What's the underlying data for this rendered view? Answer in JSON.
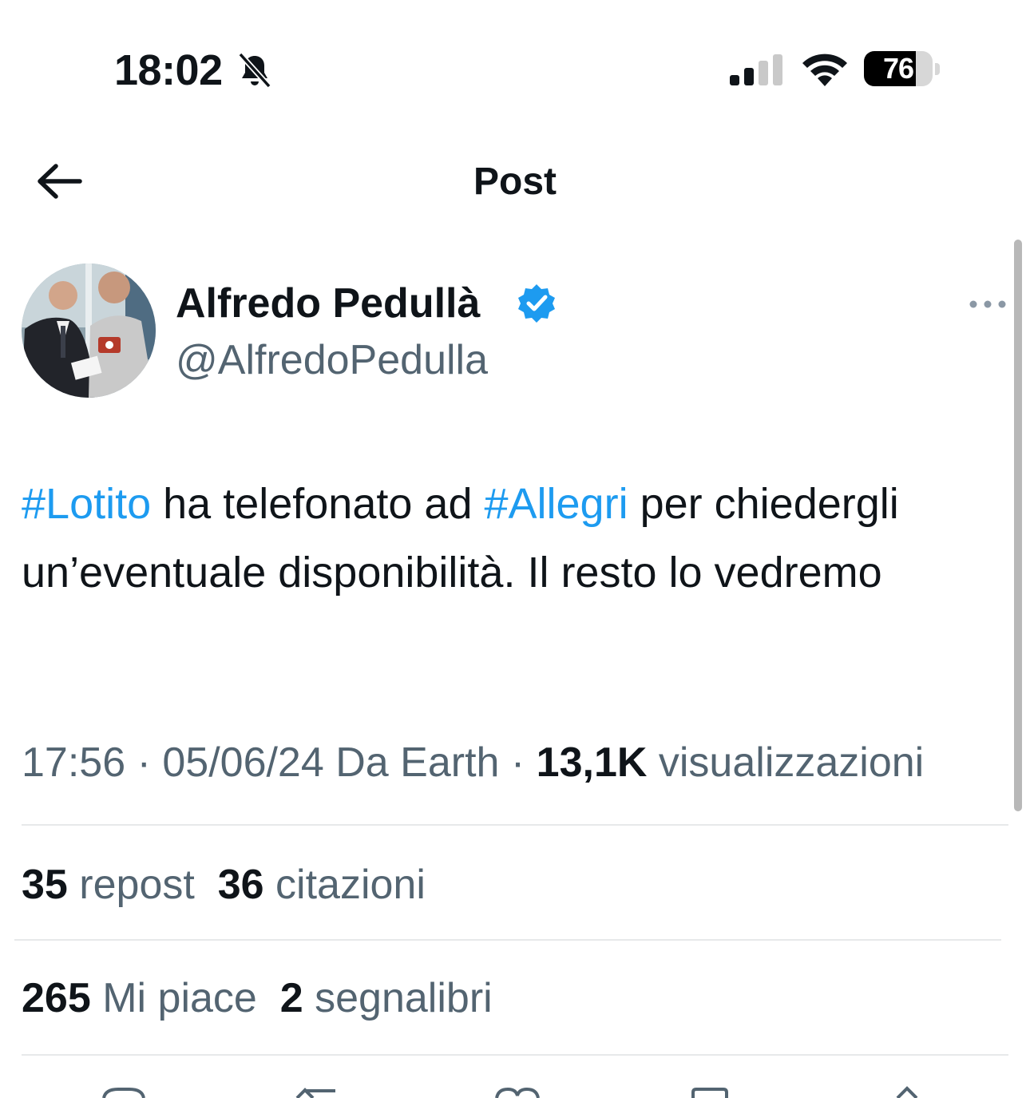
{
  "status_bar": {
    "time": "18:02",
    "battery_level": "76",
    "battery_fraction": 0.76,
    "icons": [
      "bell-muted-icon",
      "cellular-signal-icon",
      "wifi-icon",
      "battery-icon"
    ]
  },
  "nav": {
    "title": "Post",
    "back_icon": "arrow-left-icon"
  },
  "author": {
    "name": "Alfredo Pedullà",
    "handle": "@AlfredoPedulla",
    "verified": true,
    "verified_color": "#1d9bf0"
  },
  "post": {
    "segments": [
      {
        "text": "#Lotito",
        "hashtag": true
      },
      {
        "text": " ha telefonato ad ",
        "hashtag": false
      },
      {
        "text": "#Allegri",
        "hashtag": true
      },
      {
        "text": " per chiedergli un’eventuale disponibilità. Il resto lo vedremo",
        "hashtag": false
      }
    ],
    "hashtag_color": "#1d9bf0"
  },
  "meta": {
    "time": "17:56",
    "sep1": " · ",
    "date": "05/06/24",
    "source": " Da Earth",
    "sep2": " · ",
    "views_count": "13,1K",
    "views_label": " visualizzazioni"
  },
  "stats": {
    "reposts_count": "35",
    "reposts_label": " repost",
    "quotes_count": "36",
    "quotes_label": " citazioni",
    "likes_count": "265",
    "likes_label": " Mi piace",
    "bookmarks_count": "2",
    "bookmarks_label": " segnalibri"
  },
  "actions": [
    "reply-icon",
    "repost-icon",
    "like-icon",
    "bookmark-icon",
    "share-icon"
  ]
}
